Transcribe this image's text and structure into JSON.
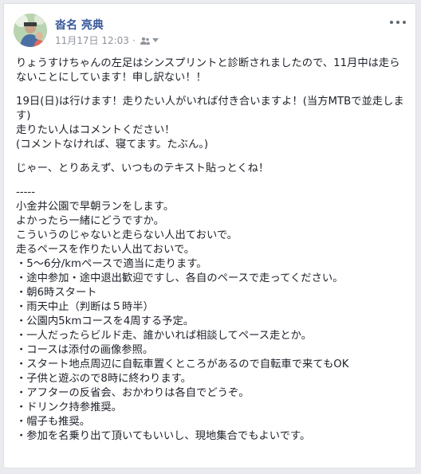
{
  "post": {
    "author": "沓名 亮典",
    "timestamp": "11月17日 12:03",
    "separator": "·",
    "paragraphs": [
      "りょうすけちゃんの左足はシンスプリントと診断されましたので、11月中は走らないことにしています！申し訳ない！！",
      "19日(日)は行けます！走りたい人がいれば付き合いますよ！(当方MTBで並走します)\n走りたい人はコメントください！\n(コメントなければ、寝てます。たぶん。)",
      "じゃー、とりあえず、いつものテキスト貼っとくね！"
    ],
    "template_lines": [
      "-----",
      "小金井公園で早朝ランをします。",
      "よかったら一緒にどうですか。",
      "こういうのじゃないと走らない人出ておいで。",
      "走るペースを作りたい人出ておいで。",
      "・5〜6分/kmペースで適当に走ります。",
      "・途中参加・途中退出歓迎ですし、各自のペースで走ってください。",
      "・朝6時スタート",
      "・雨天中止（判断は５時半）",
      "・公園内5kmコースを4周する予定。",
      "・一人だったらビルド走、誰かいれば相談してペース走とか。",
      "・コースは添付の画像参照。",
      "・スタート地点周辺に自転車置くところがあるので自転車で来てもOK",
      "・子供と遊ぶので8時に終わります。",
      "・アフターの反省会、おかわりは各自でどうぞ。",
      "・ドリンク持参推奨。",
      "・帽子も推奨。",
      "・参加を名乗り出て頂いてもいいし、現地集合でもよいです。"
    ]
  },
  "icons": {
    "audience": "friends-icon",
    "audience_menu": "caret-down-icon",
    "more": "more-options-icon"
  },
  "colors": {
    "author": "#365899",
    "meta": "#90949c",
    "text": "#1d2129",
    "background": "#e9ebee"
  }
}
